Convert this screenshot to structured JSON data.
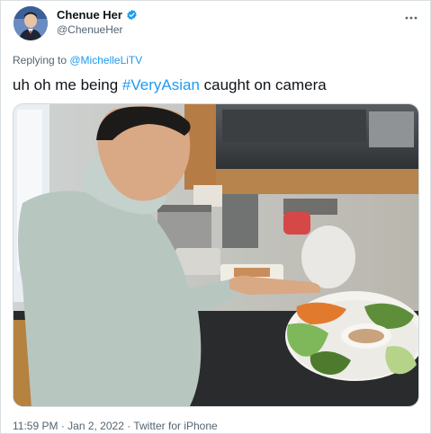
{
  "author": {
    "name": "Chenue Her",
    "handle": "@ChenueHer"
  },
  "reply": {
    "prefix": "Replying to ",
    "target": "@MichelleLiTV"
  },
  "tweet": {
    "before": "uh oh me being ",
    "hashtag": "#VeryAsian",
    "after": " caught on camera"
  },
  "meta": {
    "time": "11:59 PM",
    "sep1": " · ",
    "date": "Jan 2, 2022",
    "sep2": " · ",
    "source": "Twitter for iPhone"
  },
  "colors": {
    "link": "#1d9bf0",
    "secondary_text": "#536471"
  },
  "icons": {
    "verified": "verified-badge-icon",
    "more": "more-options-icon"
  }
}
